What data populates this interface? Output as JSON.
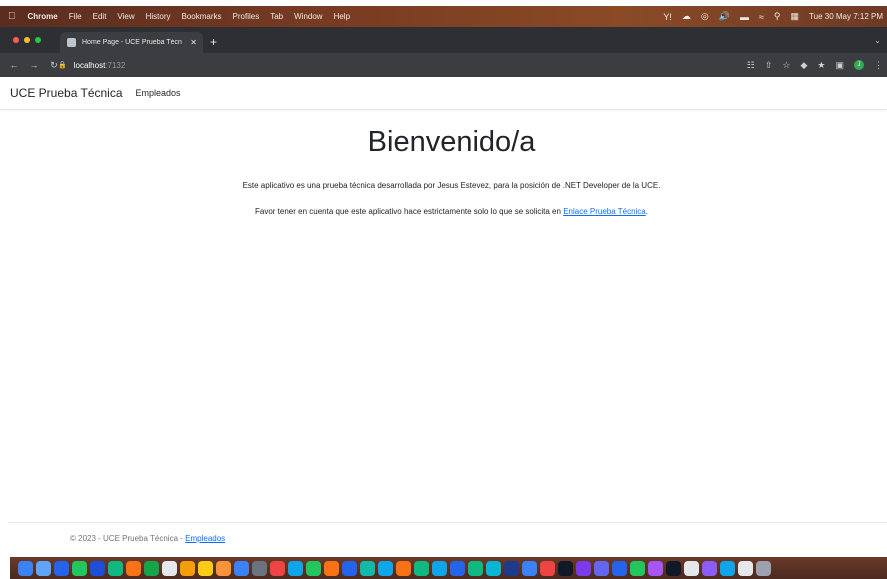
{
  "menubar": {
    "app": "Chrome",
    "items": [
      "File",
      "Edit",
      "View",
      "History",
      "Bookmarks",
      "Profiles",
      "Tab",
      "Window",
      "Help"
    ],
    "clock": "Tue 30 May  7:12 PM",
    "status_icons": [
      "network-activity-icon",
      "cloud-icon",
      "focus-icon",
      "volume-icon",
      "battery-icon",
      "wifi-icon",
      "spotlight-icon",
      "control-center-icon"
    ]
  },
  "browser": {
    "tab_title": "Home Page - UCE Prueba Técn",
    "url_host": "localhost",
    "url_port": ":7132"
  },
  "site": {
    "brand": "UCE Prueba Técnica",
    "nav_link": "Empleados"
  },
  "main": {
    "title": "Bienvenido/a",
    "paragraph1": "Este aplicativo es una prueba técnica desarrollada por Jesus Estevez, para la posición de .NET Developer de la UCE.",
    "paragraph2_prefix": "Favor tener en cuenta que este aplicativo hace estrictamente solo lo que se solicita en ",
    "paragraph2_link": "Enlace Prueba Técnica",
    "paragraph2_suffix": "."
  },
  "footer": {
    "text": "© 2023 - UCE Prueba Técnica - ",
    "link": "Empleados"
  },
  "colors": {
    "link": "#0d6efd",
    "text": "#212529",
    "footer_text": "#6c757d",
    "browser_chrome": "#3c3d41",
    "traffic_red": "#ff5f57",
    "traffic_yellow": "#febc2e",
    "traffic_green": "#28c840"
  },
  "dock": {
    "app_colors": [
      "#3b82f6",
      "#60a5fa",
      "#2563eb",
      "#22c55e",
      "#1d4ed8",
      "#10b981",
      "#f97316",
      "#16a34a",
      "#e5e7eb",
      "#f59e0b",
      "#facc15",
      "#fb923c",
      "#3b82f6",
      "#6b7280",
      "#ef4444",
      "#0ea5e9",
      "#22c55e",
      "#f97316",
      "#2563eb",
      "#14b8a6",
      "#0ea5e9",
      "#f97316",
      "#10b981",
      "#0ea5e9",
      "#2563eb",
      "#10b981",
      "#06b6d4",
      "#1e3a8a",
      "#3b82f6",
      "#ef4444",
      "#111827",
      "#7c3aed",
      "#6366f1",
      "#2563eb",
      "#22c55e",
      "#a855f7",
      "#111827",
      "#e5e7eb",
      "#8b5cf6",
      "#0ea5e9",
      "#e5e7eb",
      "#9ca3af"
    ]
  }
}
